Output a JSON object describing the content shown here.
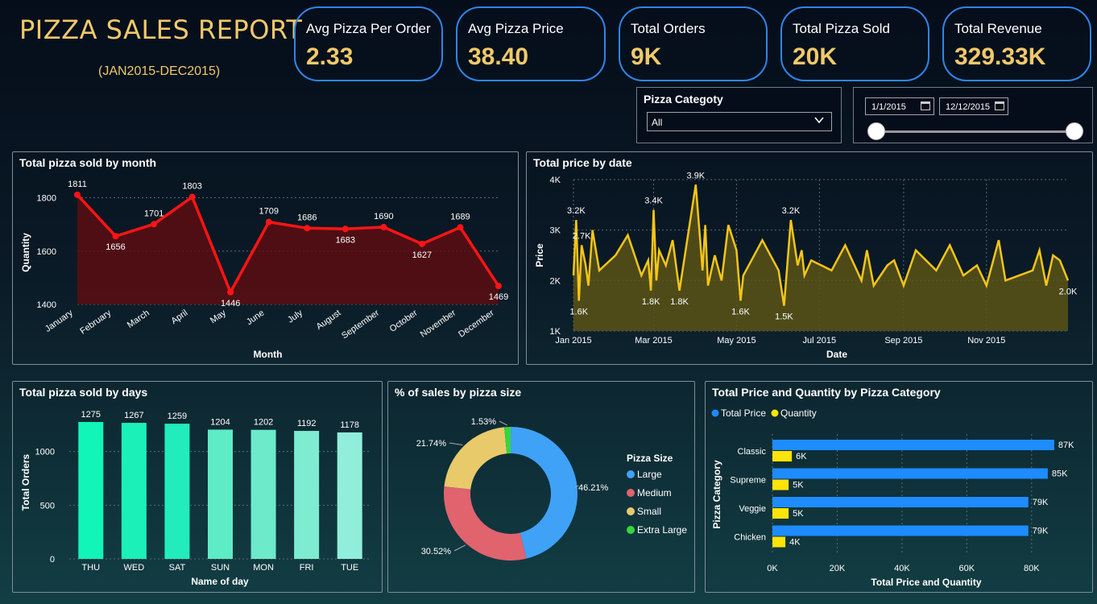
{
  "header": {
    "title": "PIZZA SALES REPORT",
    "subtitle": "(JAN2015-DEC2015)"
  },
  "kpis": [
    {
      "label": "Avg Pizza Per Order",
      "value": "2.33"
    },
    {
      "label": "Avg Pizza Price",
      "value": "38.40"
    },
    {
      "label": "Total Orders",
      "value": "9K"
    },
    {
      "label": "Total Pizza Sold",
      "value": "20K"
    },
    {
      "label": "Total Revenue",
      "value": "329.33K"
    }
  ],
  "filters": {
    "category_title": "Pizza Categoty",
    "category_selected": "All",
    "date_start": "1/1/2015",
    "date_end": "12/12/2015"
  },
  "colors": {
    "accent": "#f0c96a",
    "kpi_border": "#2f86ea",
    "month_line": "#ff1414",
    "price_line": "#f5c518",
    "total_price_bar": "#1e8cff",
    "quantity_bar": "#ffe40a"
  },
  "chart_data": [
    {
      "id": "month",
      "type": "line",
      "title": "Total pizza sold by month",
      "xlabel": "Month",
      "ylabel": "Quantity",
      "categories": [
        "January",
        "February",
        "March",
        "April",
        "May",
        "June",
        "July",
        "August",
        "September",
        "October",
        "November",
        "December"
      ],
      "values": [
        1811,
        1656,
        1701,
        1803,
        1446,
        1709,
        1686,
        1683,
        1690,
        1627,
        1689,
        1469
      ],
      "ylim": [
        1400,
        1850
      ],
      "yticks": [
        1400,
        1600,
        1800
      ],
      "grid": true
    },
    {
      "id": "date",
      "type": "area",
      "title": "Total price by date",
      "xlabel": "Date",
      "ylabel": "Price",
      "yticks": [
        1000,
        2000,
        3000,
        4000
      ],
      "ytick_labels": [
        "1K",
        "2K",
        "3K",
        "4K"
      ],
      "xtick_labels": [
        "Jan 2015",
        "Mar 2015",
        "May 2015",
        "Jul 2015",
        "Sep 2015",
        "Nov 2015"
      ],
      "ylim": [
        1000,
        4000
      ],
      "x": [
        "2015-01-01",
        "2015-01-03",
        "2015-01-05",
        "2015-01-07",
        "2015-01-10",
        "2015-01-12",
        "2015-01-15",
        "2015-01-20",
        "2015-02-01",
        "2015-02-10",
        "2015-02-20",
        "2015-02-25",
        "2015-02-27",
        "2015-03-01",
        "2015-03-03",
        "2015-03-05",
        "2015-03-10",
        "2015-03-15",
        "2015-03-20",
        "2015-04-01",
        "2015-04-06",
        "2015-04-08",
        "2015-04-10",
        "2015-04-15",
        "2015-04-20",
        "2015-04-25",
        "2015-05-01",
        "2015-05-04",
        "2015-05-06",
        "2015-05-10",
        "2015-05-20",
        "2015-06-01",
        "2015-06-05",
        "2015-06-10",
        "2015-06-15",
        "2015-06-18",
        "2015-06-20",
        "2015-06-25",
        "2015-07-10",
        "2015-07-20",
        "2015-08-01",
        "2015-08-05",
        "2015-08-10",
        "2015-08-20",
        "2015-08-25",
        "2015-09-01",
        "2015-09-10",
        "2015-09-25",
        "2015-10-05",
        "2015-10-15",
        "2015-10-25",
        "2015-11-01",
        "2015-11-10",
        "2015-11-15",
        "2015-11-25",
        "2015-12-05",
        "2015-12-10",
        "2015-12-15",
        "2015-12-20",
        "2015-12-25",
        "2015-12-31"
      ],
      "values": [
        2100,
        3200,
        1600,
        2700,
        2300,
        1900,
        3000,
        2200,
        2500,
        2900,
        2100,
        2400,
        1800,
        3400,
        2000,
        2600,
        2300,
        2800,
        1800,
        3900,
        2200,
        3100,
        1900,
        2500,
        2000,
        3100,
        2600,
        1600,
        2100,
        2300,
        2800,
        2200,
        1500,
        3200,
        2300,
        2600,
        2100,
        2400,
        2200,
        2700,
        2000,
        2600,
        1900,
        2300,
        2400,
        1900,
        2600,
        2200,
        2700,
        2100,
        2300,
        1900,
        2800,
        2000,
        2100,
        2200,
        2600,
        1900,
        2500,
        2400,
        2000
      ],
      "data_labels": [
        {
          "x": "2015-01-03",
          "label": "3.2K"
        },
        {
          "x": "2015-01-07",
          "label": "2.7K"
        },
        {
          "x": "2015-01-05",
          "label": "1.6K"
        },
        {
          "x": "2015-03-01",
          "label": "3.4K"
        },
        {
          "x": "2015-02-27",
          "label": "1.8K"
        },
        {
          "x": "2015-04-01",
          "label": "3.9K"
        },
        {
          "x": "2015-03-20",
          "label": "1.8K"
        },
        {
          "x": "2015-05-04",
          "label": "1.6K"
        },
        {
          "x": "2015-06-10",
          "label": "3.2K"
        },
        {
          "x": "2015-06-05",
          "label": "1.5K"
        },
        {
          "x": "2015-12-31",
          "label": "2.0K"
        }
      ],
      "grid": true
    },
    {
      "id": "days",
      "type": "bar",
      "title": "Total pizza sold by days",
      "xlabel": "Name of day",
      "ylabel": "Total Orders",
      "categories": [
        "THU",
        "WED",
        "SAT",
        "SUN",
        "MON",
        "FRI",
        "TUE"
      ],
      "values": [
        1275,
        1267,
        1259,
        1204,
        1202,
        1192,
        1178
      ],
      "ylim": [
        0,
        1350
      ],
      "yticks": [
        0,
        500,
        1000
      ],
      "grid": true
    },
    {
      "id": "size",
      "type": "pie",
      "title": "% of sales by pizza size",
      "legend_title": "Pizza Size",
      "legend_position": "right",
      "categories": [
        "Large",
        "Medium",
        "Small",
        "Extra Large"
      ],
      "values": [
        46.21,
        30.52,
        21.74,
        1.53
      ],
      "labels": [
        "46.21%",
        "30.52%",
        "21.74%",
        "1.53%"
      ],
      "colors": [
        "#3fa2f7",
        "#e0636e",
        "#e8ca6a",
        "#35d63c"
      ]
    },
    {
      "id": "category",
      "type": "bar",
      "orientation": "horizontal",
      "title": "Total Price and Quantity by Pizza Category",
      "xlabel": "Total Price and Quantity",
      "ylabel": "Pizza Category",
      "categories": [
        "Classic",
        "Supreme",
        "Veggie",
        "Chicken"
      ],
      "series": [
        {
          "name": "Total Price",
          "values": [
            87000,
            85000,
            79000,
            79000
          ],
          "labels": [
            "87K",
            "85K",
            "79K",
            "79K"
          ]
        },
        {
          "name": "Quantity",
          "values": [
            6000,
            5000,
            5000,
            4000
          ],
          "labels": [
            "6K",
            "5K",
            "5K",
            "4K"
          ]
        }
      ],
      "xlim": [
        0,
        90000
      ],
      "xticks": [
        0,
        20000,
        40000,
        60000,
        80000
      ],
      "xtick_labels": [
        "0K",
        "20K",
        "40K",
        "60K",
        "80K"
      ],
      "legend_position": "top-left",
      "grid": true
    }
  ]
}
